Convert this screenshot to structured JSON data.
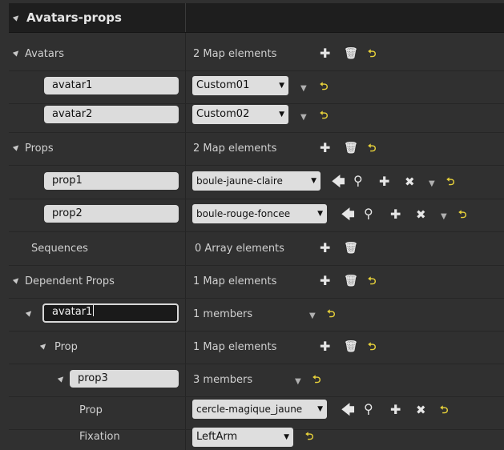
{
  "header": {
    "title": "Avatars-props"
  },
  "rows": {
    "avatars": {
      "label": "Avatars",
      "value": "2 Map elements"
    },
    "avatar1": {
      "key": "avatar1",
      "combo": "Custom01"
    },
    "avatar2": {
      "key": "avatar2",
      "combo": "Custom02"
    },
    "props": {
      "label": "Props",
      "value": "2 Map elements"
    },
    "prop1": {
      "key": "prop1",
      "combo": "boule-jaune-claire"
    },
    "prop2": {
      "key": "prop2",
      "combo": "boule-rouge-foncee"
    },
    "sequences": {
      "label": "Sequences",
      "value": "0 Array elements"
    },
    "dependent": {
      "label": "Dependent Props",
      "value": "1 Map elements"
    },
    "dep_avatar1": {
      "key": "avatar1",
      "value": "1 members"
    },
    "dep_prop": {
      "label": "Prop",
      "value": "1 Map elements"
    },
    "prop3": {
      "key": "prop3",
      "value": "3 members"
    },
    "prop3_prop": {
      "label": "Prop",
      "combo": "cercle-magique_jaune"
    },
    "fixation": {
      "label": "Fixation",
      "combo": "LeftArm"
    }
  },
  "icons": {
    "expand": "▲",
    "add": "✚",
    "delete": "🗑",
    "reset": "⮌",
    "dropdown": "▼",
    "use_selected": "🡄",
    "browse": "⚲",
    "clear": "✖"
  }
}
